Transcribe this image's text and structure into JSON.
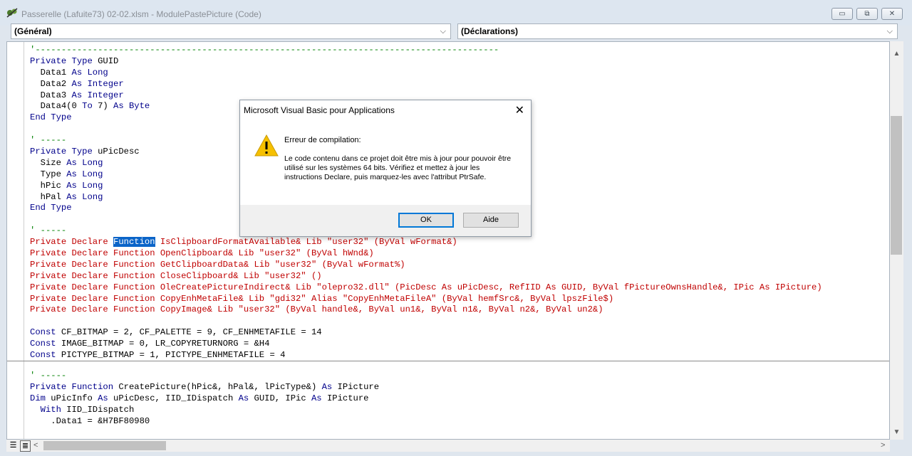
{
  "window": {
    "title": "Passerelle (Lafuite73) 02-02.xlsm - ModulePastePicture (Code)",
    "buttons": {
      "minimize": "▭",
      "maximize": "⧉",
      "close": "✕"
    }
  },
  "object_combo": {
    "value": "(Général)"
  },
  "procedure_combo": {
    "value": "(Déclarations)"
  },
  "code_top": [
    [
      {
        "t": "'-----------------------------------------------------------------------------------------",
        "c": "c"
      }
    ],
    [
      {
        "t": "Private Type ",
        "c": "k"
      },
      {
        "t": "GUID",
        "c": ""
      }
    ],
    [
      {
        "t": "  Data1 ",
        "c": ""
      },
      {
        "t": "As Long",
        "c": "k"
      }
    ],
    [
      {
        "t": "  Data2 ",
        "c": ""
      },
      {
        "t": "As Integer",
        "c": "k"
      }
    ],
    [
      {
        "t": "  Data3 ",
        "c": ""
      },
      {
        "t": "As Integer",
        "c": "k"
      }
    ],
    [
      {
        "t": "  Data4(0 ",
        "c": ""
      },
      {
        "t": "To",
        "c": "k"
      },
      {
        "t": " 7) ",
        "c": ""
      },
      {
        "t": "As Byte",
        "c": "k"
      }
    ],
    [
      {
        "t": "End Type",
        "c": "k"
      }
    ],
    [
      {
        "t": "",
        "c": ""
      }
    ],
    [
      {
        "t": "' -----",
        "c": "c"
      }
    ],
    [
      {
        "t": "Private Type ",
        "c": "k"
      },
      {
        "t": "uPicDesc",
        "c": ""
      }
    ],
    [
      {
        "t": "  Size ",
        "c": ""
      },
      {
        "t": "As Long",
        "c": "k"
      }
    ],
    [
      {
        "t": "  Type ",
        "c": ""
      },
      {
        "t": "As Long",
        "c": "k"
      }
    ],
    [
      {
        "t": "  hPic ",
        "c": ""
      },
      {
        "t": "As Long",
        "c": "k"
      }
    ],
    [
      {
        "t": "  hPal ",
        "c": ""
      },
      {
        "t": "As Long",
        "c": "k"
      }
    ],
    [
      {
        "t": "End Type",
        "c": "k"
      }
    ],
    [
      {
        "t": "",
        "c": ""
      }
    ],
    [
      {
        "t": "' -----",
        "c": "c"
      }
    ],
    [
      {
        "t": "Private Declare ",
        "c": "r"
      },
      {
        "t": "Function",
        "c": "sel"
      },
      {
        "t": " IsClipboardFormatAvailable& Lib \"user32\" (ByVal wFormat&)",
        "c": "r"
      }
    ],
    [
      {
        "t": "Private Declare Function OpenClipboard& Lib \"user32\" (ByVal hWnd&)",
        "c": "r"
      }
    ],
    [
      {
        "t": "Private Declare Function GetClipboardData& Lib \"user32\" (ByVal wFormat%)",
        "c": "r"
      }
    ],
    [
      {
        "t": "Private Declare Function CloseClipboard& Lib \"user32\" ()",
        "c": "r"
      }
    ],
    [
      {
        "t": "Private Declare Function OleCreatePictureIndirect& Lib \"olepro32.dll\" (PicDesc As uPicDesc, RefIID As GUID, ByVal fPictureOwnsHandle&, IPic As IPicture)",
        "c": "r"
      }
    ],
    [
      {
        "t": "Private Declare Function CopyEnhMetaFile& Lib \"gdi32\" Alias \"CopyEnhMetaFileA\" (ByVal hemfSrc&, ByVal lpszFile$)",
        "c": "r"
      }
    ],
    [
      {
        "t": "Private Declare Function CopyImage& Lib \"user32\" (ByVal handle&, ByVal un1&, ByVal n1&, ByVal n2&, ByVal un2&)",
        "c": "r"
      }
    ],
    [
      {
        "t": "",
        "c": ""
      }
    ],
    [
      {
        "t": "Const ",
        "c": "k"
      },
      {
        "t": "CF_BITMAP = 2, CF_PALETTE = 9, CF_ENHMETAFILE = 14",
        "c": ""
      }
    ],
    [
      {
        "t": "Const ",
        "c": "k"
      },
      {
        "t": "IMAGE_BITMAP = 0, LR_COPYRETURNORG = &H4",
        "c": ""
      }
    ],
    [
      {
        "t": "Const ",
        "c": "k"
      },
      {
        "t": "PICTYPE_BITMAP = 1, PICTYPE_ENHMETAFILE = 4",
        "c": ""
      }
    ]
  ],
  "code_bottom": [
    [
      {
        "t": "' -----",
        "c": "c"
      }
    ],
    [
      {
        "t": "Private Function ",
        "c": "k"
      },
      {
        "t": "CreatePicture(hPic&, hPal&, lPicType&) ",
        "c": ""
      },
      {
        "t": "As ",
        "c": "k"
      },
      {
        "t": "IPicture",
        "c": ""
      }
    ],
    [
      {
        "t": "Dim ",
        "c": "k"
      },
      {
        "t": "uPicInfo ",
        "c": ""
      },
      {
        "t": "As ",
        "c": "k"
      },
      {
        "t": "uPicDesc, IID_IDispatch ",
        "c": ""
      },
      {
        "t": "As ",
        "c": "k"
      },
      {
        "t": "GUID, IPic ",
        "c": ""
      },
      {
        "t": "As ",
        "c": "k"
      },
      {
        "t": "IPicture",
        "c": ""
      }
    ],
    [
      {
        "t": "  With ",
        "c": "k"
      },
      {
        "t": "IID_IDispatch",
        "c": ""
      }
    ],
    [
      {
        "t": "    .Data1 = &H7BF80980",
        "c": ""
      }
    ]
  ],
  "dialog": {
    "title": "Microsoft Visual Basic pour Applications",
    "close": "✕",
    "heading": "Erreur de compilation:",
    "message": "Le code contenu dans ce projet doit être mis à jour pour pouvoir être utilisé sur les systèmes 64 bits. Vérifiez et mettez à jour les instructions Declare, puis marquez-les avec l'attribut PtrSafe.",
    "ok_label": "OK",
    "help_label": "Aide"
  },
  "scroll": {
    "up": "▲",
    "down": "▼",
    "left": "<",
    "right": ">"
  }
}
